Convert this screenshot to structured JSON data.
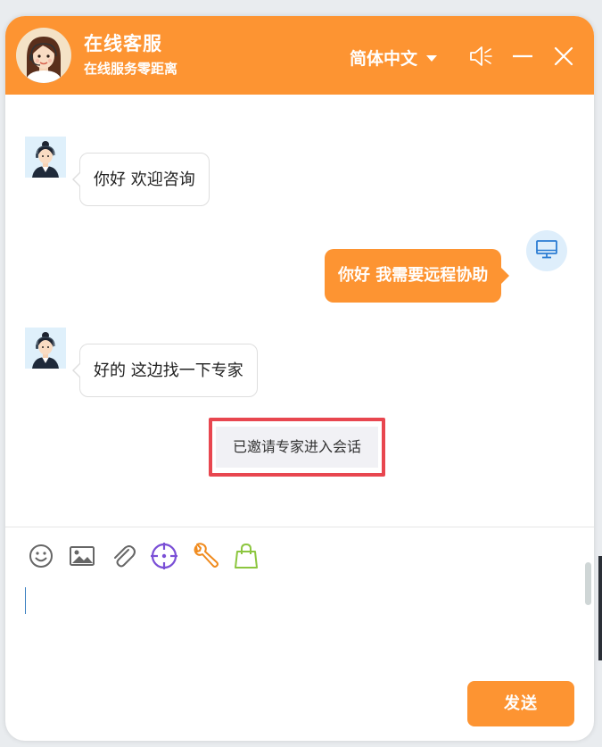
{
  "header": {
    "title": "在线客服",
    "subtitle": "在线服务零距离",
    "language": "简体中文"
  },
  "messages": [
    {
      "from": "agent",
      "text": "你好 欢迎咨询"
    },
    {
      "from": "user",
      "text": "你好 我需要远程协助"
    },
    {
      "from": "agent",
      "text": "好的 这边找一下专家"
    }
  ],
  "system_note": "已邀请专家进入会话",
  "composer": {
    "input_value": "",
    "tools": [
      "smiley-icon",
      "image-icon",
      "paperclip-icon",
      "crosshair-icon",
      "wrench-icon",
      "shopping-bag-icon"
    ],
    "send_label": "发送"
  },
  "colors": {
    "accent": "#fd9432",
    "highlight_border": "#e8464f",
    "crosshair": "#7a4fd6",
    "wrench": "#f08a1c",
    "bag": "#8cc63f"
  }
}
